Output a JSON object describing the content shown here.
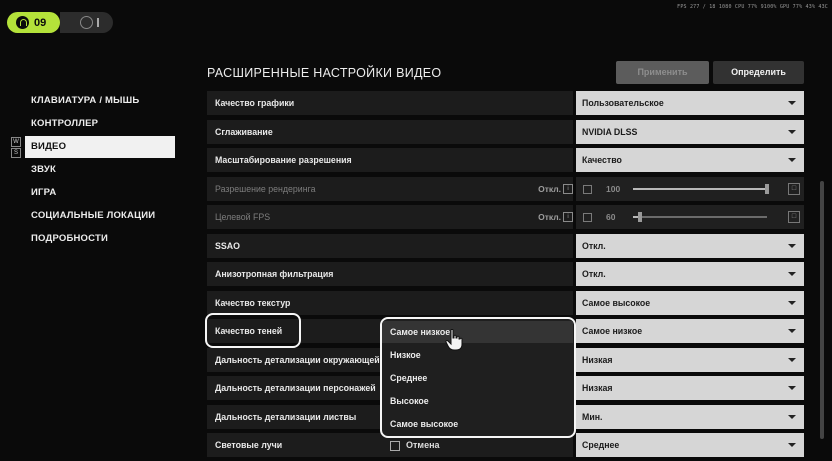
{
  "topbar": {
    "badge_count": "09",
    "perf_overlay": "FPS 277 / 18 1080 CPU 77% 9100% GPU 77% 43% 43C"
  },
  "sidebar": {
    "items": [
      {
        "label": "КЛАВИАТУРА / МЫШЬ"
      },
      {
        "label": "КОНТРОЛЛЕР"
      },
      {
        "label": "ВИДЕО"
      },
      {
        "label": "ЗВУК"
      },
      {
        "label": "ИГРА"
      },
      {
        "label": "СОЦИАЛЬНЫЕ ЛОКАЦИИ"
      },
      {
        "label": "ПОДРОБНОСТИ"
      }
    ],
    "keys": [
      "W",
      "S"
    ]
  },
  "header": {
    "title": "РАСШИРЕННЫЕ НАСТРОЙКИ ВИДЕО",
    "apply_label": "Применить",
    "define_label": "Определить"
  },
  "rows": [
    {
      "label": "Качество графики",
      "value": "Пользовательское"
    },
    {
      "label": "Сглаживание",
      "value": "NVIDIA DLSS"
    },
    {
      "label": "Масштабирование разрешения",
      "value": "Качество"
    },
    {
      "label": "Разрешение рендеринга",
      "off": "Откл.",
      "slider_value": "100",
      "slider_fraction": 1.0
    },
    {
      "label": "Целевой FPS",
      "off": "Откл.",
      "slider_value": "60",
      "slider_fraction": 0.05
    },
    {
      "label": "SSAO",
      "value": "Откл."
    },
    {
      "label": "Анизотропная фильтрация",
      "value": "Откл."
    },
    {
      "label": "Качество текстур",
      "value": "Самое высокое"
    },
    {
      "label": "Качество теней",
      "value": "Самое низкое"
    },
    {
      "label": "Дальность детализации окружающей",
      "value": "Низкая"
    },
    {
      "label": "Дальность детализации персонажей",
      "value": "Низкая"
    },
    {
      "label": "Дальность детализации листвы",
      "value": "Мин."
    },
    {
      "label": "Световые лучи",
      "value": "Среднее"
    }
  ],
  "dropdown": {
    "options": [
      "Самое низкое",
      "Низкое",
      "Среднее",
      "Высокое",
      "Самое высокое"
    ],
    "selected_index": 0
  },
  "footer": {
    "cancel_label": "Отмена"
  }
}
